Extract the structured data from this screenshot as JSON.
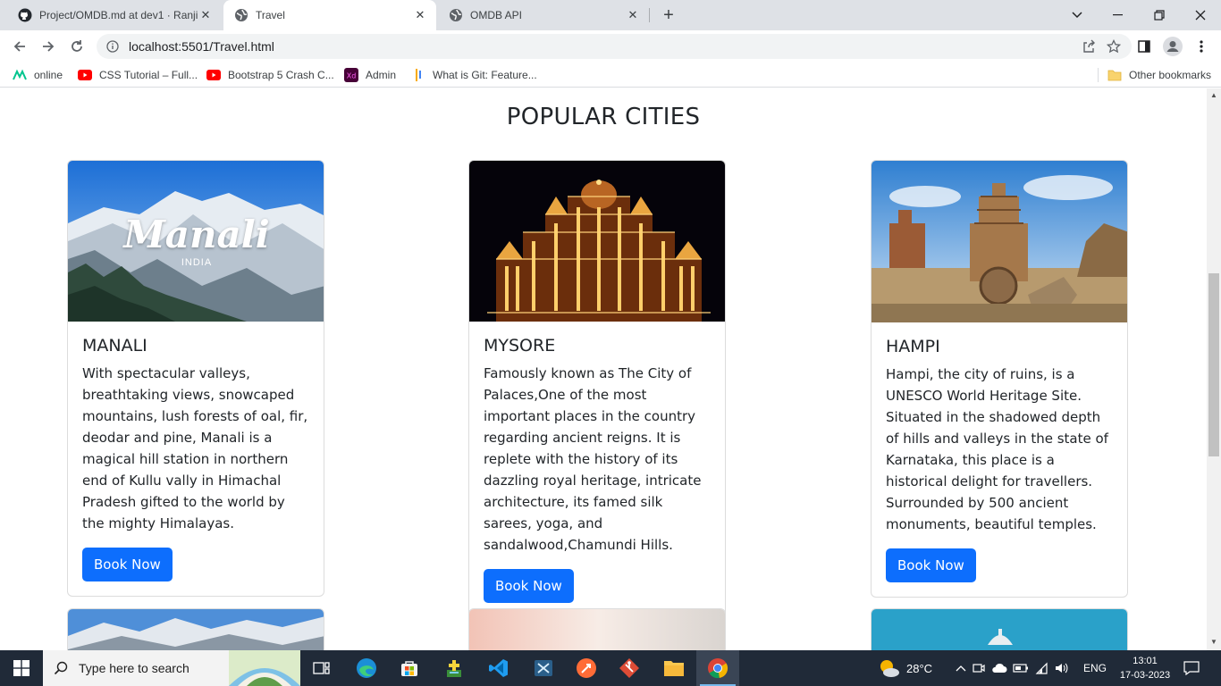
{
  "browser": {
    "tabs": [
      {
        "title": "Project/OMDB.md at dev1 · Ranji",
        "icon": "github-icon"
      },
      {
        "title": "Travel",
        "icon": "globe-icon"
      },
      {
        "title": "OMDB API",
        "icon": "globe-icon"
      }
    ],
    "url": "localhost:5501/Travel.html",
    "bookmarks": [
      {
        "label": "online",
        "icon": "online-icon"
      },
      {
        "label": "CSS Tutorial – Full...",
        "icon": "youtube-icon"
      },
      {
        "label": "Bootstrap 5 Crash C...",
        "icon": "youtube-icon"
      },
      {
        "label": "Admin",
        "icon": "adobe-xd-icon"
      },
      {
        "label": "What is Git: Feature...",
        "icon": "git-icon"
      }
    ],
    "other_bookmarks": "Other bookmarks"
  },
  "page": {
    "heading": "POPULAR CITIES",
    "cards": [
      {
        "title": "MANALI",
        "image_text": "Manali",
        "image_subtext": "INDIA",
        "text": "With spectacular valleys, breathtaking views, snowcaped mountains, lush forests of oal, fir, deodar and pine, Manali is a magical hill station in northern end of Kullu vally in Himachal Pradesh gifted to the world by the mighty Himalayas.",
        "button": "Book Now"
      },
      {
        "title": "MYSORE",
        "text": "Famously known as The City of Palaces,One of the most important places in the country regarding ancient reigns. It is replete with the history of its dazzling royal heritage, intricate architecture, its famed silk sarees, yoga, and sandalwood,Chamundi Hills.",
        "button": "Book Now"
      },
      {
        "title": "HAMPI",
        "text": "Hampi, the city of ruins, is a UNESCO World Heritage Site. Situated in the shadowed depth of hills and valleys in the state of Karnataka, this place is a historical delight for travellers. Surrounded by 500 ancient monuments, beautiful temples.",
        "button": "Book Now"
      }
    ],
    "colors": {
      "button": "#0d6efd",
      "heading": "#212529"
    }
  },
  "taskbar": {
    "search_placeholder": "Type here to search",
    "weather": "28°C",
    "language": "ENG",
    "time": "13:01",
    "date": "17-03-2023"
  }
}
